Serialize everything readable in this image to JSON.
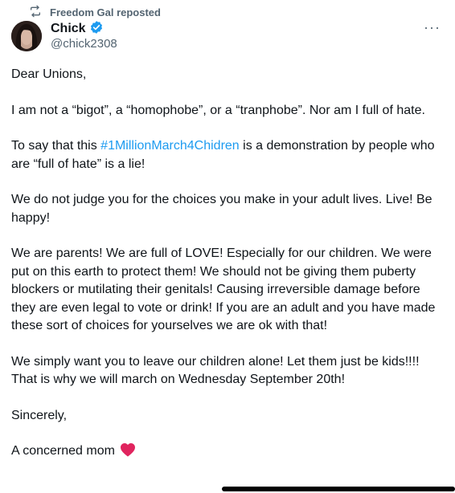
{
  "repost": {
    "text": "Freedom Gal reposted"
  },
  "author": {
    "name": "Chick",
    "handle": "@chick2308"
  },
  "more_label": "···",
  "post": {
    "p1": "Dear Unions,",
    "p2": "I am not a “bigot”, a “homophobe”, or a “tranphobe”. Nor am I full of hate.",
    "p3_pre": "To say that this ",
    "p3_hashtag": "#1MillionMarch4Chidren",
    "p3_post": " is a demonstration by people who are “full of hate” is a lie!",
    "p4": "We do not judge you for the choices you make in your adult lives. Live! Be happy!",
    "p5": "We are parents! We are full of LOVE! Especially for our children. We were put on this earth to protect them! We  should not be giving them puberty blockers or mutilating their genitals! Causing irreversible damage before they are even legal to vote or drink! If you are an adult and you have made these sort of choices for yourselves we are ok with that!",
    "p6": "We simply want you to leave our children alone! Let them just be kids!!!! That is why we will march on Wednesday September 20th!",
    "p7": "Sincerely,",
    "p8": "A concerned mom"
  },
  "colors": {
    "accent": "#1d9bf0",
    "heart": "#e0245e",
    "muted": "#536471"
  }
}
